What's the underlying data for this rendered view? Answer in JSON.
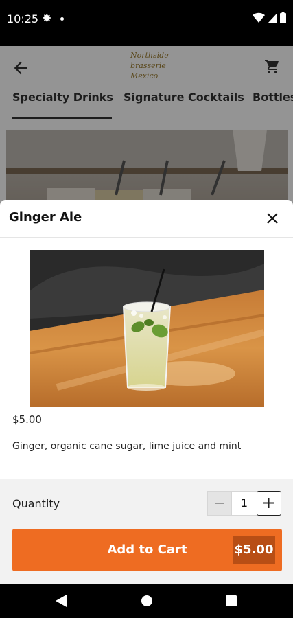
{
  "status_bar": {
    "time": "10:25"
  },
  "header": {
    "logo_lines": [
      "Northside",
      "brasserie",
      "Mexico"
    ]
  },
  "tabs": [
    {
      "label": "Specialty Drinks",
      "active": true
    },
    {
      "label": "Signature Cocktails",
      "active": false
    },
    {
      "label": "Bottles",
      "active": false
    }
  ],
  "sheet": {
    "title": "Ginger Ale",
    "price": "$5.00",
    "description": "Ginger, organic cane sugar, lime juice and mint",
    "quantity_label": "Quantity",
    "quantity": "1",
    "add_to_cart_label": "Add to Cart",
    "add_to_cart_price": "$5.00"
  },
  "colors": {
    "accent": "#ee6c22",
    "accent_dark": "#b84e15"
  },
  "icons": [
    "gear-icon",
    "wifi-icon",
    "signal-icon",
    "battery-icon",
    "back-arrow-icon",
    "cart-icon",
    "close-icon",
    "minus-icon",
    "plus-icon",
    "nav-back-icon",
    "nav-home-icon",
    "nav-recents-icon"
  ]
}
